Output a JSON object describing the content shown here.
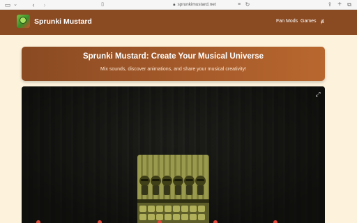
{
  "browser": {
    "url": "sprunkimustard.net"
  },
  "header": {
    "brand": "Sprunki Mustard",
    "nav": [
      {
        "label": "Fan Mods"
      },
      {
        "label": "Games"
      }
    ],
    "language_icon": "translate-icon"
  },
  "hero": {
    "title": "Sprunki Mustard: Create Your Musical Universe",
    "subtitle": "Mix sounds, discover animations, and share your musical creativity!"
  },
  "game": {
    "fullscreen_icon": "expand-icon"
  },
  "colors": {
    "header_bg": "#8a4a22",
    "page_bg": "#fdf3dd",
    "hero_gradient_end": "#b8672e",
    "game_bg": "#151513"
  }
}
